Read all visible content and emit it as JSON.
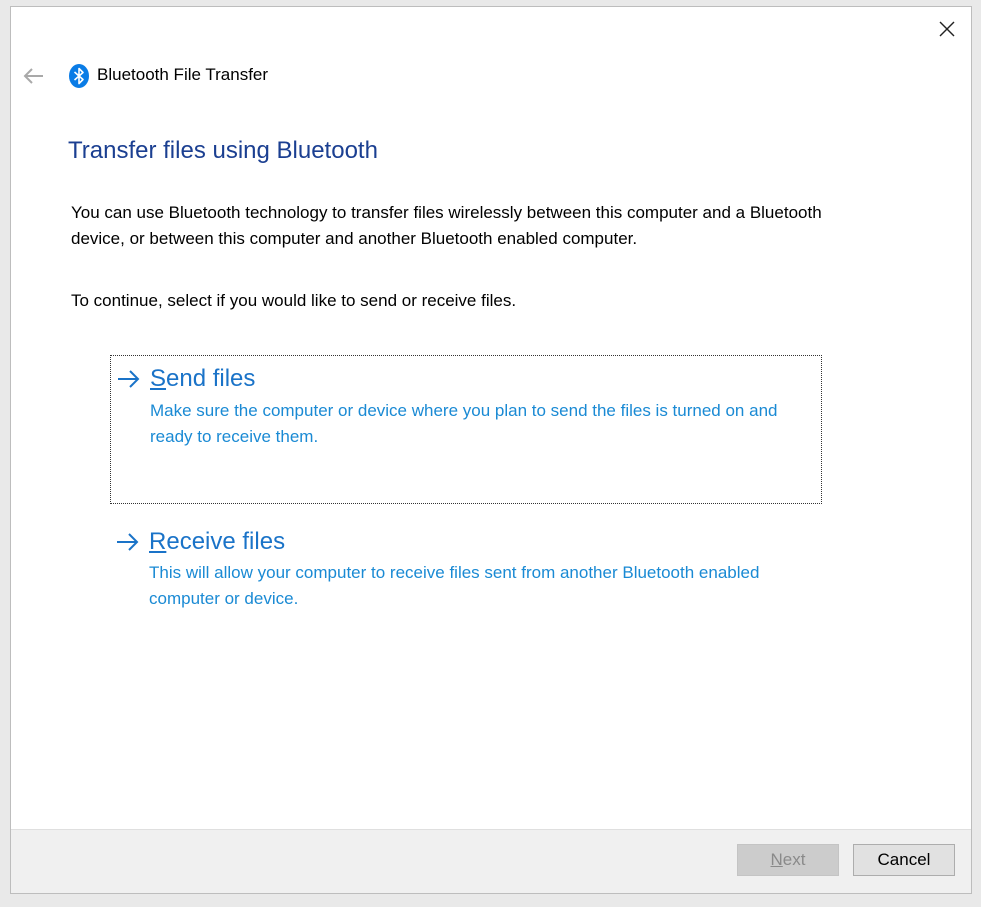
{
  "window": {
    "title": "Bluetooth File Transfer",
    "icons": {
      "close": "close-icon",
      "back": "back-arrow-icon",
      "app": "bluetooth-icon"
    }
  },
  "page": {
    "heading": "Transfer files using Bluetooth",
    "intro": "You can use Bluetooth technology to transfer files wirelessly between this computer and a Bluetooth device, or between this computer and another Bluetooth enabled computer.",
    "instruction": "To continue, select if you would like to send or receive files."
  },
  "options": [
    {
      "title_first": "S",
      "title_rest": "end files",
      "description": "Make sure the computer or device where you plan to send the files is turned on and ready to receive them.",
      "focused": true
    },
    {
      "title_first": "R",
      "title_rest": "eceive files",
      "description": "This will allow your computer to receive files sent from another Bluetooth enabled computer or device.",
      "focused": false
    }
  ],
  "footer": {
    "next_first": "N",
    "next_rest": "ext",
    "next_enabled": false,
    "cancel_label": "Cancel"
  },
  "colors": {
    "heading": "#1b3f91",
    "link": "#1a73c8",
    "link_desc": "#1a8ad4",
    "bluetooth": "#0a7ce6"
  }
}
